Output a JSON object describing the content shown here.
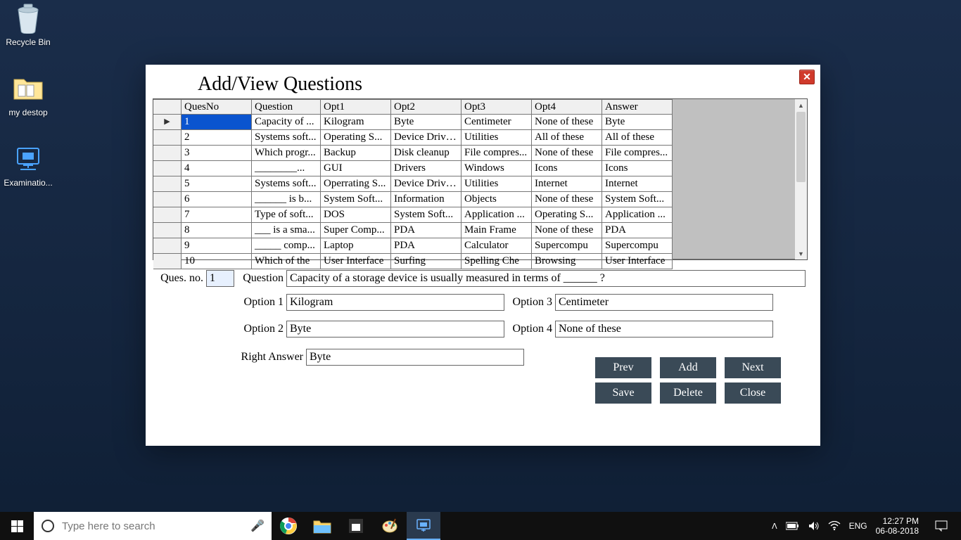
{
  "desktop": {
    "icons": [
      {
        "name": "recycle-bin",
        "label": "Recycle Bin"
      },
      {
        "name": "my-desktop-folder",
        "label": "my destop"
      },
      {
        "name": "examination-app",
        "label": "Examinatio..."
      }
    ]
  },
  "window": {
    "title": "Add/View Questions",
    "grid": {
      "headers": [
        "",
        "QuesNo",
        "Question",
        "Opt1",
        "Opt2",
        "Opt3",
        "Opt4",
        "Answer"
      ],
      "rows": [
        [
          "▶",
          "1",
          "Capacity of ...",
          "Kilogram",
          "Byte",
          "Centimeter",
          "None of these",
          "Byte"
        ],
        [
          "",
          "2",
          "Systems soft...",
          "Operating S...",
          "Device Drivers",
          "Utilities",
          "All of these",
          "All of these"
        ],
        [
          "",
          "3",
          "Which progr...",
          "Backup",
          "Disk cleanup",
          "File compres...",
          "None of these",
          "File compres..."
        ],
        [
          "",
          "4",
          "________...",
          "GUI",
          "Drivers",
          "Windows",
          "Icons",
          "Icons"
        ],
        [
          "",
          "5",
          "Systems soft...",
          "Operrating S...",
          "Device Drivers",
          "Utilities",
          "Internet",
          "Internet"
        ],
        [
          "",
          "6",
          "______ is b...",
          "System Soft...",
          "Information",
          "Objects",
          "None of these",
          "System Soft..."
        ],
        [
          "",
          "7",
          "Type of soft...",
          "DOS",
          "System Soft...",
          "Application ...",
          "Operating S...",
          "Application ..."
        ],
        [
          "",
          "8",
          "___ is a sma...",
          "Super Comp...",
          "PDA",
          "Main Frame",
          "None of these",
          "PDA"
        ],
        [
          "",
          "9",
          "_____ comp...",
          "Laptop",
          "PDA",
          "Calculator",
          "Supercompu",
          "Supercompu"
        ],
        [
          "",
          "10",
          "Which of the",
          "User Interface",
          "Surfing",
          "Spelling Che",
          "Browsing",
          "User Interface"
        ]
      ],
      "selected": {
        "row": 0,
        "col": 1
      }
    },
    "form": {
      "ques_no_label": "Ques. no.",
      "ques_no_value": "1",
      "question_label": "Question",
      "question_value": "Capacity of a storage device is usually measured in terms of ______ ?",
      "option1_label": "Option 1",
      "option1_value": "Kilogram",
      "option2_label": "Option 2",
      "option2_value": "Byte",
      "option3_label": "Option 3",
      "option3_value": "Centimeter",
      "option4_label": "Option 4",
      "option4_value": "None of these",
      "right_answer_label": "Right Answer",
      "right_answer_value": "Byte"
    },
    "buttons": {
      "prev": "Prev",
      "add": "Add",
      "next": "Next",
      "save": "Save",
      "delete": "Delete",
      "close": "Close"
    }
  },
  "taskbar": {
    "search_placeholder": "Type here to search",
    "lang": "ENG",
    "time": "12:27 PM",
    "date": "06-08-2018"
  }
}
